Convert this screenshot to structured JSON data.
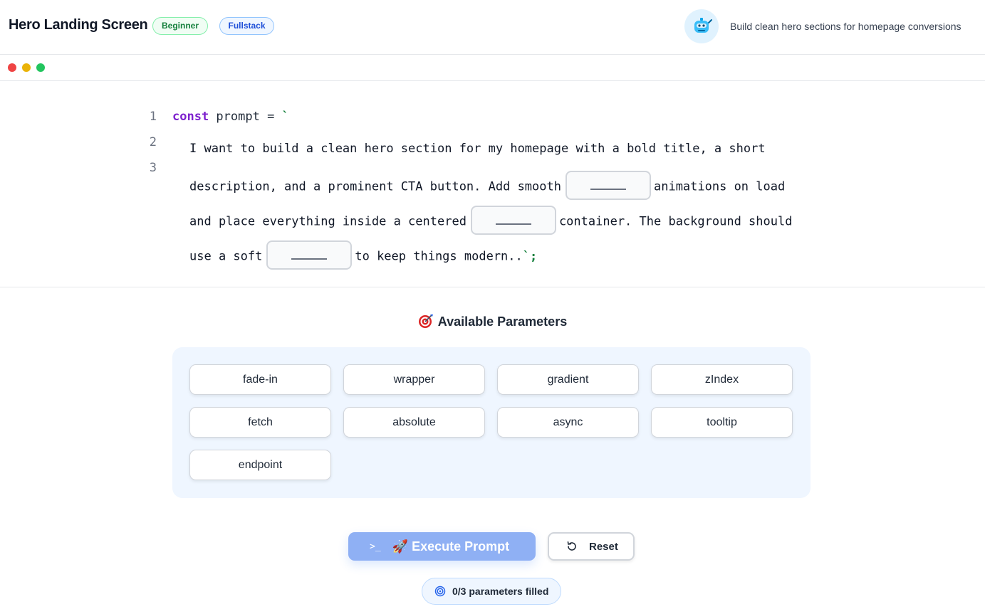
{
  "header": {
    "title": "Hero Landing Screen",
    "badges": [
      "Beginner",
      "Fullstack"
    ],
    "avatar_icon": "robot-icon",
    "tagline": "Build clean hero sections for homepage conversions"
  },
  "window_controls": [
    "close",
    "minimize",
    "maximize"
  ],
  "code": {
    "line_numbers": [
      "1",
      "2",
      "3"
    ],
    "keyword": "const",
    "identifier": " prompt = ",
    "open_quote": "`",
    "segments": [
      "I want to build a clean hero section for my homepage with a bold title, a short",
      "description, and a prominent CTA button. Add smooth",
      "animations on load",
      "and place everything inside a centered",
      "container. The background should",
      "use a soft",
      "to keep things modern.."
    ],
    "close_quote": "`;",
    "blank_placeholder": "_____"
  },
  "parameters": {
    "title": "Available Parameters",
    "icon": "target-icon",
    "items": [
      "fade-in",
      "wrapper",
      "gradient",
      "zIndex",
      "fetch",
      "absolute",
      "async",
      "tooltip",
      "endpoint"
    ]
  },
  "actions": {
    "execute_icon_text": ">_",
    "execute_label": "🚀 Execute Prompt",
    "reset_label": "Reset"
  },
  "status": {
    "text": "0/3 parameters filled"
  },
  "colors": {
    "keyword": "#7e22ce",
    "string": "#15803d",
    "execute_button": "#8fb0f4",
    "params_bg": "#eff6ff"
  }
}
